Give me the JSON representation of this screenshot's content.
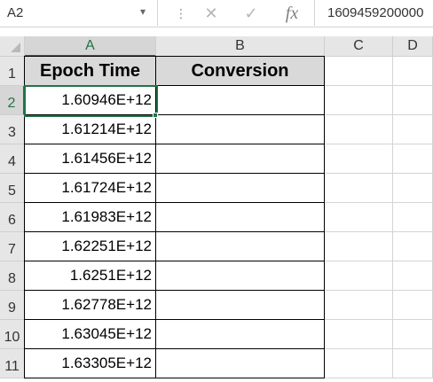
{
  "formula_bar": {
    "name_box": "A2",
    "formula": "1609459200000",
    "dropdown_icon": "chevron-down-icon",
    "cancel_icon": "cancel-icon",
    "enter_icon": "checkmark-icon",
    "function_icon": "fx-icon"
  },
  "columns": [
    "A",
    "B",
    "C",
    "D"
  ],
  "rows": [
    "1",
    "2",
    "3",
    "4",
    "5",
    "6",
    "7",
    "8",
    "9",
    "10",
    "11"
  ],
  "sheet": {
    "headers": {
      "a1": "Epoch Time",
      "b1": "Conversion"
    },
    "values": [
      "1.60946E+12",
      "1.61214E+12",
      "1.61456E+12",
      "1.61724E+12",
      "1.61983E+12",
      "1.62251E+12",
      "1.6251E+12",
      "1.62778E+12",
      "1.63045E+12",
      "1.63305E+12"
    ],
    "conversions": [
      "",
      "",
      "",
      "",
      "",
      "",
      "",
      "",
      "",
      ""
    ]
  },
  "colors": {
    "selection": "#217346",
    "header_fill": "#d9d9d9",
    "grid": "#d4d4d4"
  }
}
